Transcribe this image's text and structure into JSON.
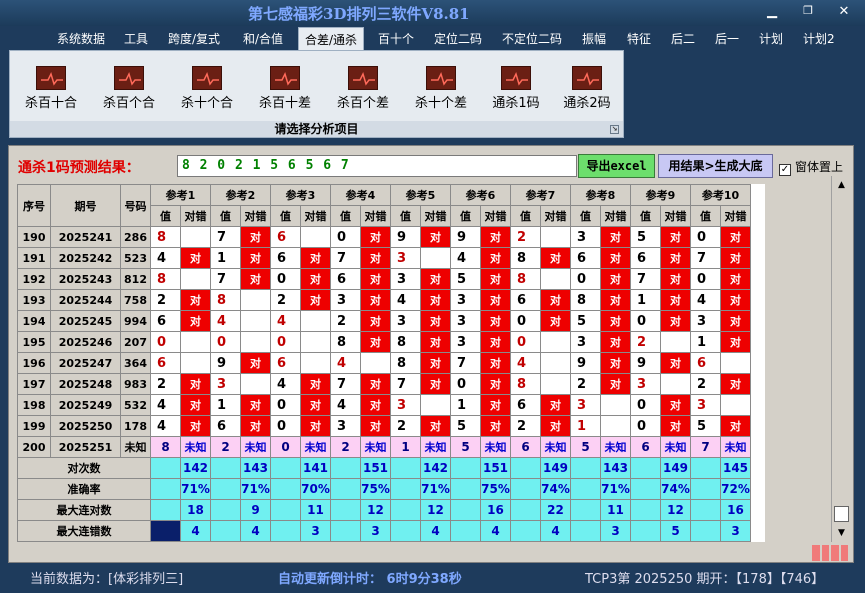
{
  "window": {
    "title": "第七感福彩3D排列三软件V8.81"
  },
  "menu": [
    "系统数据",
    "工具",
    "跨度/复式",
    "和/合值",
    "合差/通杀",
    "百十个",
    "定位二码",
    "不定位二码",
    "振幅",
    "特征",
    "后二",
    "后一",
    "计划",
    "计划2"
  ],
  "menu_active": "合差/通杀",
  "ribbon": {
    "items": [
      "杀百十合",
      "杀百个合",
      "杀十个合",
      "杀百十差",
      "杀百个差",
      "杀十个差",
      "通杀1码",
      "通杀2码"
    ],
    "caption": "请选择分析项目"
  },
  "panel": {
    "label": "通杀1码预测结果：",
    "prediction": "8 2 0 2 1 5 6 5 6 7",
    "export_btn": "导出excel",
    "gen_btn": "用结果>生成大底",
    "pin_label": "窗体置上",
    "pin_checked": "✓"
  },
  "table": {
    "col_seq": "序号",
    "col_period": "期号",
    "col_code": "号码",
    "refs": [
      "参考1",
      "参考2",
      "参考3",
      "参考4",
      "参考5",
      "参考6",
      "参考7",
      "参考8",
      "参考9",
      "参考10"
    ],
    "sub_val": "值",
    "sub_hit": "对错",
    "hit_text": "对",
    "rows": [
      {
        "seq": "190",
        "period": "2025241",
        "code": "286",
        "refs": [
          [
            "8",
            false
          ],
          [
            "7",
            true
          ],
          [
            "6",
            false
          ],
          [
            "0",
            true
          ],
          [
            "9",
            true
          ],
          [
            "9",
            true
          ],
          [
            "2",
            false
          ],
          [
            "3",
            true
          ],
          [
            "5",
            true
          ],
          [
            "0",
            true
          ]
        ]
      },
      {
        "seq": "191",
        "period": "2025242",
        "code": "523",
        "refs": [
          [
            "4",
            true
          ],
          [
            "1",
            true
          ],
          [
            "6",
            true
          ],
          [
            "7",
            true
          ],
          [
            "3",
            false
          ],
          [
            "4",
            true
          ],
          [
            "8",
            true
          ],
          [
            "6",
            true
          ],
          [
            "6",
            true
          ],
          [
            "7",
            true
          ]
        ]
      },
      {
        "seq": "192",
        "period": "2025243",
        "code": "812",
        "refs": [
          [
            "8",
            false
          ],
          [
            "7",
            true
          ],
          [
            "0",
            true
          ],
          [
            "6",
            true
          ],
          [
            "3",
            true
          ],
          [
            "5",
            true
          ],
          [
            "8",
            false
          ],
          [
            "0",
            true
          ],
          [
            "7",
            true
          ],
          [
            "0",
            true
          ]
        ]
      },
      {
        "seq": "193",
        "period": "2025244",
        "code": "758",
        "refs": [
          [
            "2",
            true
          ],
          [
            "8",
            false
          ],
          [
            "2",
            true
          ],
          [
            "3",
            true
          ],
          [
            "4",
            true
          ],
          [
            "3",
            true
          ],
          [
            "6",
            true
          ],
          [
            "8",
            true
          ],
          [
            "1",
            true
          ],
          [
            "4",
            true
          ]
        ]
      },
      {
        "seq": "194",
        "period": "2025245",
        "code": "994",
        "refs": [
          [
            "6",
            true
          ],
          [
            "4",
            false
          ],
          [
            "4",
            false
          ],
          [
            "2",
            true
          ],
          [
            "3",
            true
          ],
          [
            "3",
            true
          ],
          [
            "0",
            true
          ],
          [
            "5",
            true
          ],
          [
            "0",
            true
          ],
          [
            "3",
            true
          ]
        ]
      },
      {
        "seq": "195",
        "period": "2025246",
        "code": "207",
        "refs": [
          [
            "0",
            false
          ],
          [
            "0",
            false
          ],
          [
            "0",
            false
          ],
          [
            "8",
            true
          ],
          [
            "8",
            true
          ],
          [
            "3",
            true
          ],
          [
            "0",
            false
          ],
          [
            "3",
            true
          ],
          [
            "2",
            false
          ],
          [
            "1",
            true
          ]
        ]
      },
      {
        "seq": "196",
        "period": "2025247",
        "code": "364",
        "refs": [
          [
            "6",
            false
          ],
          [
            "9",
            true
          ],
          [
            "6",
            false
          ],
          [
            "4",
            false
          ],
          [
            "8",
            true
          ],
          [
            "7",
            true
          ],
          [
            "4",
            false
          ],
          [
            "9",
            true
          ],
          [
            "9",
            true
          ],
          [
            "6",
            false
          ]
        ]
      },
      {
        "seq": "197",
        "period": "2025248",
        "code": "983",
        "refs": [
          [
            "2",
            true
          ],
          [
            "3",
            false
          ],
          [
            "4",
            true
          ],
          [
            "7",
            true
          ],
          [
            "7",
            true
          ],
          [
            "0",
            true
          ],
          [
            "8",
            false
          ],
          [
            "2",
            true
          ],
          [
            "3",
            false
          ],
          [
            "2",
            true
          ]
        ]
      },
      {
        "seq": "198",
        "period": "2025249",
        "code": "532",
        "refs": [
          [
            "4",
            true
          ],
          [
            "1",
            true
          ],
          [
            "0",
            true
          ],
          [
            "4",
            true
          ],
          [
            "3",
            false
          ],
          [
            "1",
            true
          ],
          [
            "6",
            true
          ],
          [
            "3",
            false
          ],
          [
            "0",
            true
          ],
          [
            "3",
            false
          ]
        ]
      },
      {
        "seq": "199",
        "period": "2025250",
        "code": "178",
        "refs": [
          [
            "4",
            true
          ],
          [
            "6",
            true
          ],
          [
            "0",
            true
          ],
          [
            "3",
            true
          ],
          [
            "2",
            true
          ],
          [
            "5",
            true
          ],
          [
            "2",
            true
          ],
          [
            "1",
            false
          ],
          [
            "0",
            true
          ],
          [
            "5",
            true
          ]
        ]
      }
    ],
    "pred_row": {
      "seq": "200",
      "period": "2025251",
      "code": "未知",
      "unknown": "未知",
      "values": [
        "8",
        "2",
        "0",
        "2",
        "1",
        "5",
        "6",
        "5",
        "6",
        "7"
      ]
    },
    "stats": [
      {
        "label": "对次数",
        "values": [
          "142",
          "143",
          "141",
          "151",
          "142",
          "151",
          "149",
          "143",
          "149",
          "145"
        ]
      },
      {
        "label": "准确率",
        "values": [
          "71%",
          "71%",
          "70%",
          "75%",
          "71%",
          "75%",
          "74%",
          "71%",
          "74%",
          "72%"
        ]
      },
      {
        "label": "最大连对数",
        "values": [
          "18",
          "9",
          "11",
          "12",
          "12",
          "16",
          "22",
          "11",
          "12",
          "16"
        ]
      },
      {
        "label": "最大连错数",
        "values": [
          "4",
          "4",
          "3",
          "3",
          "4",
          "4",
          "4",
          "3",
          "5",
          "3"
        ]
      }
    ]
  },
  "status": {
    "data_label": "当前数据为：[体彩排列三]",
    "countdown": "自动更新倒计时：  6时9分38秒",
    "last_draw": "TCP3第  2025250  期开：【178】【746】"
  }
}
